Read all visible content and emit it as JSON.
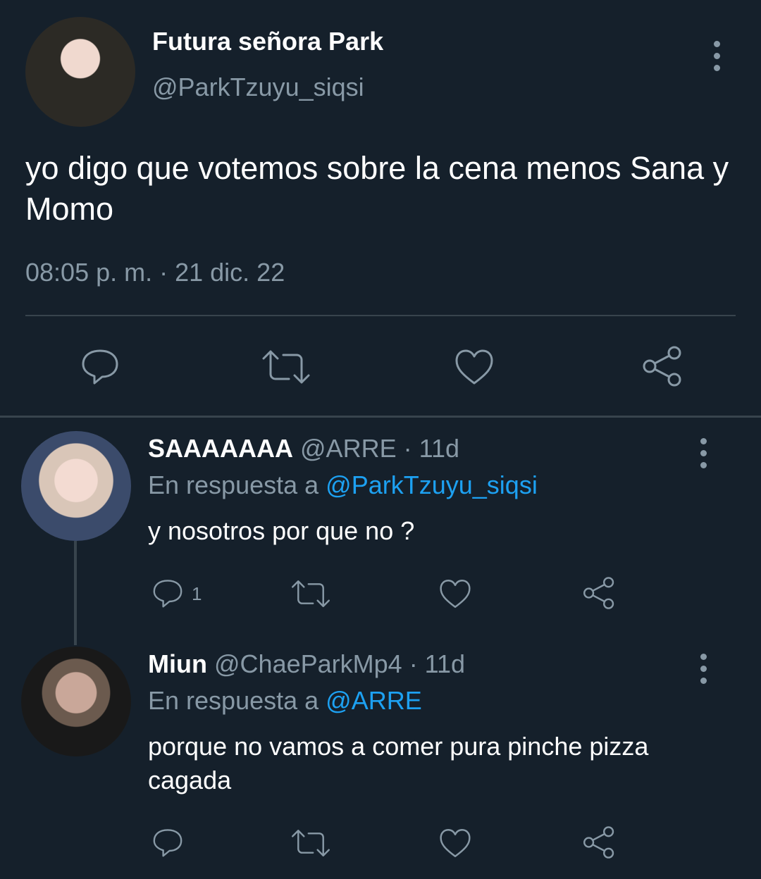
{
  "main_tweet": {
    "display_name": "Futura señora Park",
    "handle": "@ParkTzuyu_siqsi",
    "text": "yo digo que votemos sobre la cena menos Sana y Momo",
    "timestamp": "08:05 p. m. · 21 dic. 22",
    "icons": [
      "reply-icon",
      "retweet-icon",
      "like-icon",
      "share-icon",
      "more-options-icon"
    ]
  },
  "replies": [
    {
      "display_name": "SAAAAAAA",
      "handle": "@ARRE",
      "age": "· 11d",
      "reply_prefix": "En respuesta a",
      "reply_to": "@ParkTzuyu_siqsi",
      "text": "y nosotros por que no ?",
      "reply_count": "1"
    },
    {
      "display_name": "Miun",
      "handle": "@ChaeParkMp4",
      "age": "· 11d",
      "reply_prefix": "En respuesta a",
      "reply_to": "@ARRE",
      "text": "porque no vamos a comer pura pinche pizza cagada",
      "reply_count": ""
    }
  ],
  "colors": {
    "background": "#15202b",
    "muted": "#8899a6",
    "link": "#1da1f2",
    "divider": "#38444d"
  }
}
